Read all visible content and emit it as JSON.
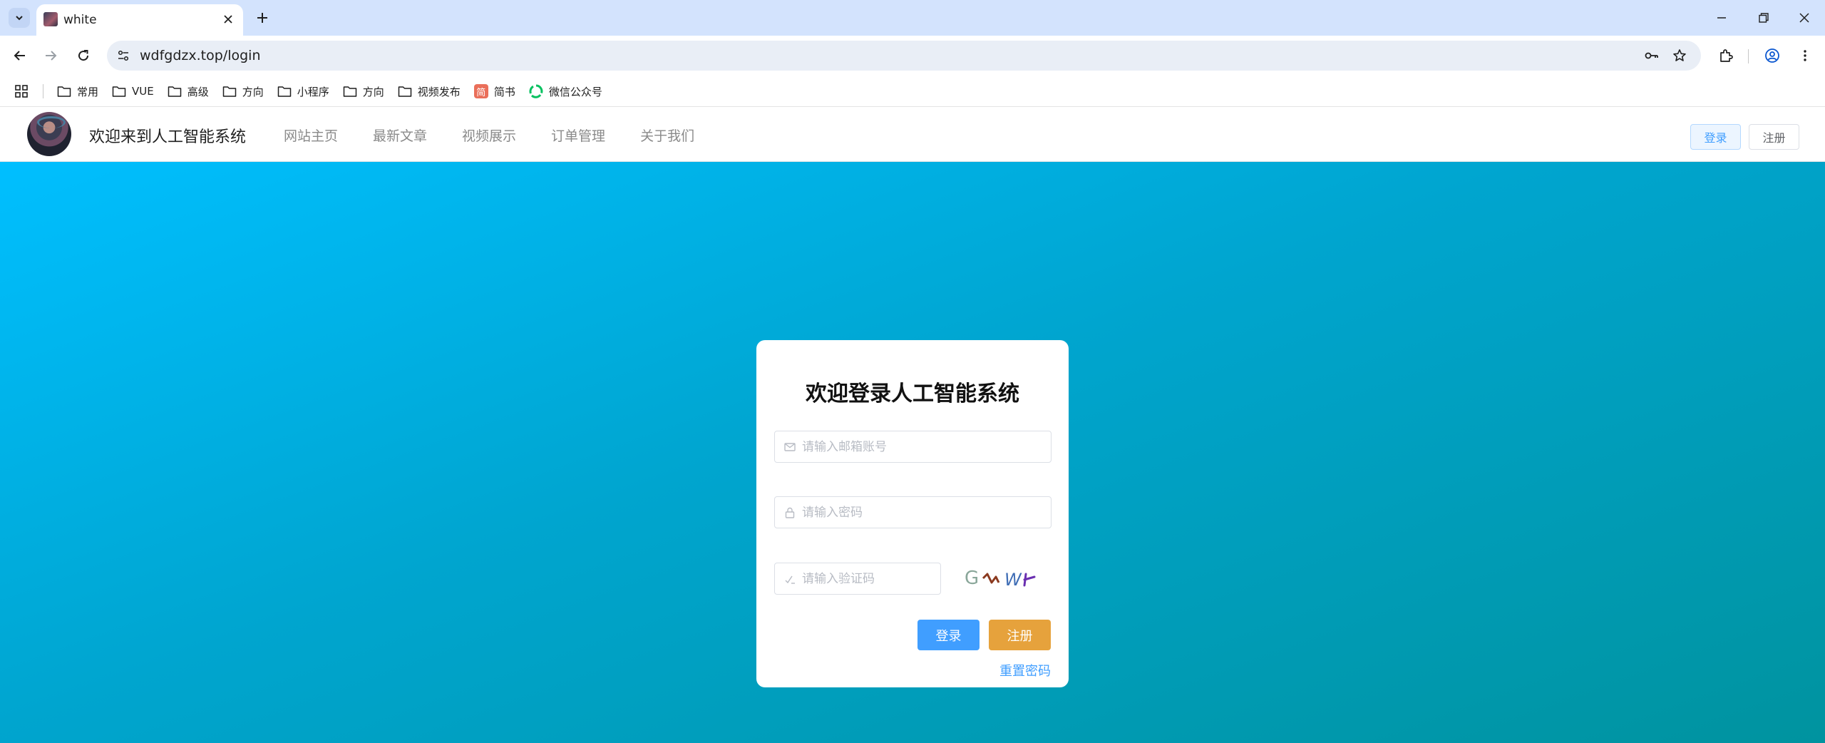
{
  "browser": {
    "tab": {
      "title": "white"
    },
    "address": {
      "url": "wdfgdzx.top/login"
    },
    "bookmarks": [
      {
        "type": "folder",
        "label": "常用"
      },
      {
        "type": "folder",
        "label": "VUE"
      },
      {
        "type": "folder",
        "label": "高级"
      },
      {
        "type": "folder",
        "label": "方向"
      },
      {
        "type": "folder",
        "label": "小程序"
      },
      {
        "type": "folder",
        "label": "方向"
      },
      {
        "type": "folder",
        "label": "视频发布"
      },
      {
        "type": "site",
        "label": "简书",
        "badge": "简"
      },
      {
        "type": "site",
        "label": "微信公众号"
      }
    ]
  },
  "site": {
    "title": "欢迎来到人工智能系统",
    "nav": [
      "网站主页",
      "最新文章",
      "视频展示",
      "订单管理",
      "关于我们"
    ],
    "header_login": "登录",
    "header_register": "注册"
  },
  "login": {
    "title": "欢迎登录人工智能系统",
    "email_placeholder": "请输入邮箱账号",
    "password_placeholder": "请输入密码",
    "code_placeholder": "请输入验证码",
    "captcha_text": "G∿Wト",
    "login_button": "登录",
    "register_button": "注册",
    "reset_link": "重置密码"
  },
  "colors": {
    "primary": "#409eff",
    "warning": "#e6a23c",
    "background_gradient_start": "#00bfff",
    "background_gradient_end": "#00939f"
  }
}
